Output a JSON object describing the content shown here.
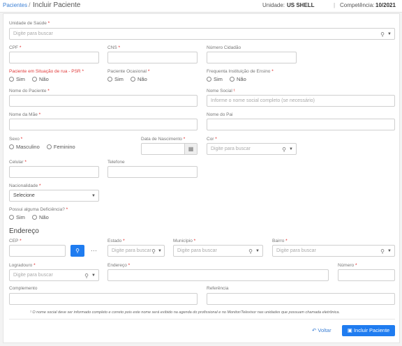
{
  "header": {
    "breadcrumb_link": "Pacientes",
    "breadcrumb_sep": "/",
    "title": "Incluir Paciente",
    "unit_label": "Unidade:",
    "unit_value": "US SHELL",
    "separator": "|",
    "competence_label": "Competência:",
    "competence_value": "10/2021"
  },
  "form": {
    "unidade_label": "Unidade de Saúde",
    "search_placeholder": "Digite para buscar",
    "cpf_label": "CPF",
    "cns_label": "CNS",
    "numero_cidadao_label": "Número Cidadão",
    "psr_label": "Paciente em Situação de rua - PSR",
    "ocasional_label": "Paciente Ocasional",
    "ensino_label": "Frequenta Instituição de Ensino",
    "sim": "Sim",
    "nao": "Não",
    "nome_paciente_label": "Nome do Paciente",
    "nome_social_label": "Nome Social",
    "nome_social_placeholder": "Informe o nome social completo (se necessário)",
    "nome_mae_label": "Nome da Mãe",
    "nome_pai_label": "Nome do Pai",
    "sexo_label": "Sexo",
    "masculino": "Masculino",
    "feminino": "Feminino",
    "nascimento_label": "Data de Nascimento",
    "cor_label": "Cor",
    "celular_label": "Celular",
    "telefone_label": "Telefone",
    "nacionalidade_label": "Nacionalidade",
    "nacionalidade_value": "Selecione",
    "deficiencia_label": "Possui alguma Deficiência?",
    "endereco_title": "Endereço",
    "cep_label": "CEP",
    "dots": "···",
    "estado_label": "Estado",
    "municipio_label": "Município",
    "bairro_label": "Bairro",
    "logradouro_label": "Logradouro",
    "endereco_label": "Endereço",
    "numero_label": "Número",
    "complemento_label": "Complemento",
    "referencia_label": "Referência",
    "footnote": "¹ O nome social deve ser informado completo e correto pois este nome será exibido na agenda do profissional e no Monitor/Televisor nas unidades que possuam chamada eletrônica.",
    "required_mark": "*",
    "superscript_mark": "¹"
  },
  "actions": {
    "back_label": "Voltar",
    "submit_label": "Incluir Paciente"
  },
  "icons": {
    "search": "search-icon",
    "calendar": "calendar-icon",
    "back": "undo-arrow-icon",
    "save": "floppy-disk-icon"
  },
  "colors": {
    "accent": "#1f7cf0",
    "link": "#3b7fd4",
    "required": "#e02020"
  }
}
